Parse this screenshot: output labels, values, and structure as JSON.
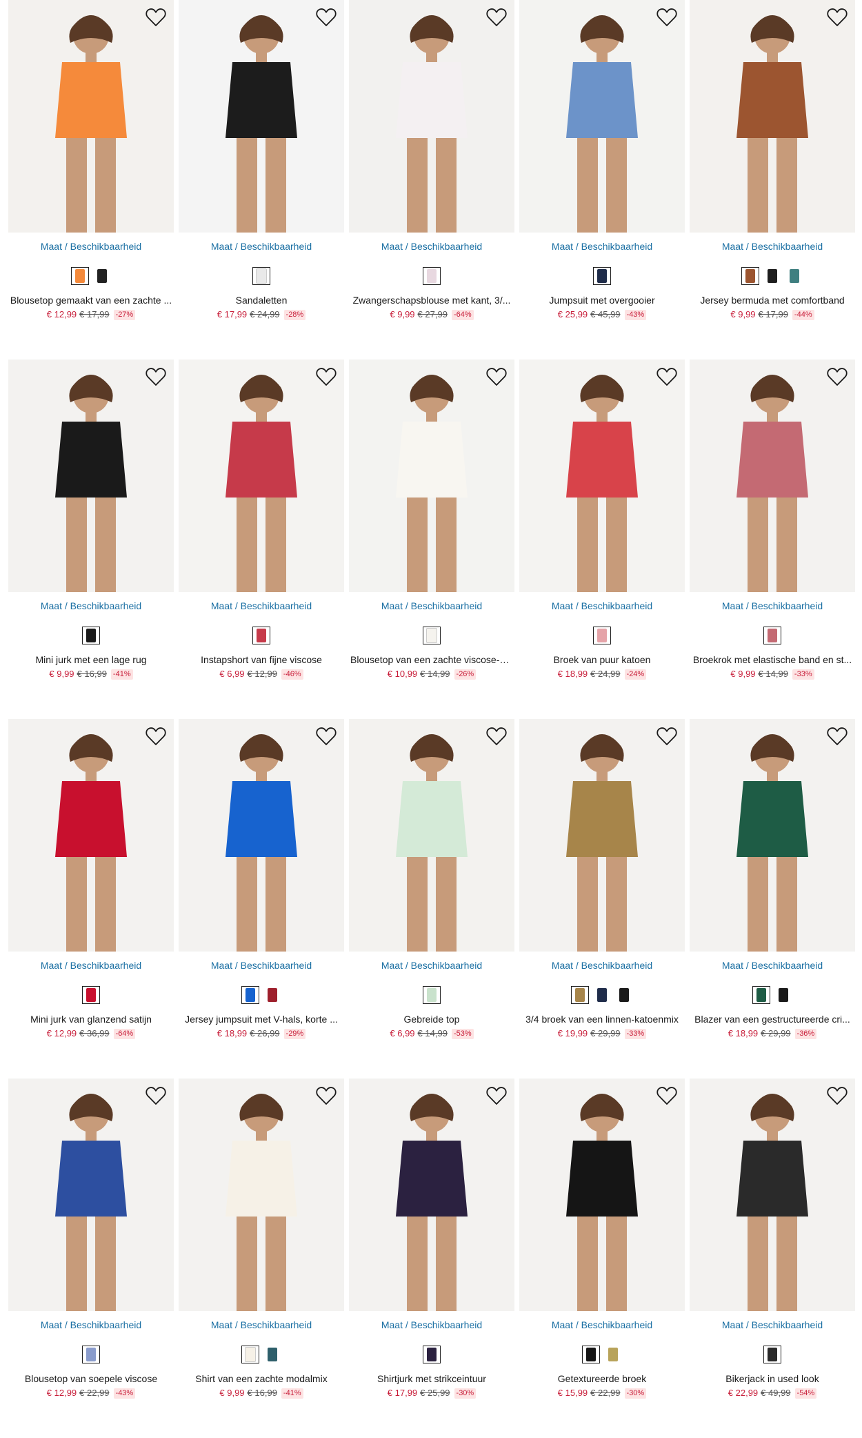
{
  "size_link_label": "Maat / Beschikbaarheid",
  "products": [
    {
      "title": "Blousetop gemaakt van een zachte ...",
      "price": "€ 12,99",
      "old_price": "€ 17,99",
      "discount": "-27%",
      "bg": "#f3f1ee",
      "garment": "#f58a3b",
      "swatches": [
        "#f58a3b",
        "#222222"
      ],
      "icon": "heart-outline-icon"
    },
    {
      "title": "Sandaletten",
      "price": "€ 17,99",
      "old_price": "€ 24,99",
      "discount": "-28%",
      "bg": "#f4f4f4",
      "garment": "#1c1c1c",
      "swatches": [
        "#e9e9e9"
      ],
      "icon": "heart-outline-icon"
    },
    {
      "title": "Zwangerschapsblouse met kant, 3/...",
      "price": "€ 9,99",
      "old_price": "€ 27,99",
      "discount": "-64%",
      "bg": "#f2f1ef",
      "garment": "#f4f0f2",
      "swatches": [
        "#e8d8e0"
      ],
      "icon": "heart-outline-icon"
    },
    {
      "title": "Jumpsuit met overgooier",
      "price": "€ 25,99",
      "old_price": "€ 45,99",
      "discount": "-43%",
      "bg": "#f3f3f1",
      "garment": "#6c93c9",
      "swatches": [
        "#1f2c4a"
      ],
      "icon": "heart-outline-icon"
    },
    {
      "title": "Jersey bermuda met comfortband",
      "price": "€ 9,99",
      "old_price": "€ 17,99",
      "discount": "-44%",
      "bg": "#f3f1ee",
      "garment": "#9c5530",
      "swatches": [
        "#9c5530",
        "#1e1e1e",
        "#3f7f80"
      ],
      "icon": "heart-outline-icon"
    },
    {
      "title": "Mini jurk met een lage rug",
      "price": "€ 9,99",
      "old_price": "€ 16,99",
      "discount": "-41%",
      "bg": "#f3f2f0",
      "garment": "#1a1a1a",
      "swatches": [
        "#1a1a1a"
      ],
      "icon": "heart-outline-icon"
    },
    {
      "title": "Instapshort van fijne viscose",
      "price": "€ 6,99",
      "old_price": "€ 12,99",
      "discount": "-46%",
      "bg": "#f4f3f1",
      "garment": "#c63a4a",
      "swatches": [
        "#c63a4a"
      ],
      "icon": "heart-outline-icon"
    },
    {
      "title": "Blousetop van een zachte viscose-mix",
      "price": "€ 10,99",
      "old_price": "€ 14,99",
      "discount": "-26%",
      "bg": "#f3f3f1",
      "garment": "#f8f6f1",
      "swatches": [
        "#f5f3ee"
      ],
      "icon": "heart-outline-icon"
    },
    {
      "title": "Broek van puur katoen",
      "price": "€ 18,99",
      "old_price": "€ 24,99",
      "discount": "-24%",
      "bg": "#f4f3f1",
      "garment": "#d8434a",
      "swatches": [
        "#e5a3a8"
      ],
      "icon": "heart-outline-icon"
    },
    {
      "title": "Broekrok met elastische band en st...",
      "price": "€ 9,99",
      "old_price": "€ 14,99",
      "discount": "-33%",
      "bg": "#f3f2f0",
      "garment": "#c46a73",
      "swatches": [
        "#c46a73"
      ],
      "icon": "heart-outline-icon"
    },
    {
      "title": "Mini jurk van glanzend satijn",
      "price": "€ 12,99",
      "old_price": "€ 36,99",
      "discount": "-64%",
      "bg": "#f3f2f0",
      "garment": "#c8102e",
      "swatches": [
        "#c8102e"
      ],
      "icon": "heart-outline-icon"
    },
    {
      "title": "Jersey jumpsuit met V-hals, korte ...",
      "price": "€ 18,99",
      "old_price": "€ 26,99",
      "discount": "-29%",
      "bg": "#f3f2f0",
      "garment": "#1763cf",
      "swatches": [
        "#1763cf",
        "#9e1f2c"
      ],
      "icon": "heart-outline-icon"
    },
    {
      "title": "Gebreide top",
      "price": "€ 6,99",
      "old_price": "€ 14,99",
      "discount": "-53%",
      "bg": "#f3f2ef",
      "garment": "#d4ead7",
      "swatches": [
        "#c9e2cc"
      ],
      "icon": "heart-outline-icon"
    },
    {
      "title": "3/4 broek van een linnen-katoenmix",
      "price": "€ 19,99",
      "old_price": "€ 29,99",
      "discount": "-33%",
      "bg": "#f3f2f0",
      "garment": "#a7854a",
      "swatches": [
        "#a7854a",
        "#1f2c4a",
        "#1a1a1a"
      ],
      "icon": "heart-outline-icon"
    },
    {
      "title": "Blazer van een gestructureerde cri...",
      "price": "€ 18,99",
      "old_price": "€ 29,99",
      "discount": "-36%",
      "bg": "#f3f2f0",
      "garment": "#1e5c45",
      "swatches": [
        "#1e5c45",
        "#1a1a1a"
      ],
      "icon": "heart-outline-icon"
    },
    {
      "title": "Blousetop van soepele viscose",
      "price": "€ 12,99",
      "old_price": "€ 22,99",
      "discount": "-43%",
      "bg": "#f3f2f0",
      "garment": "#2d4fa0",
      "swatches": [
        "#8a9ccc"
      ],
      "icon": "heart-outline-icon"
    },
    {
      "title": "Shirt van een zachte modalmix",
      "price": "€ 9,99",
      "old_price": "€ 16,99",
      "discount": "-41%",
      "bg": "#f3f2f0",
      "garment": "#f6f1e7",
      "swatches": [
        "#f6f1e7",
        "#2e5f6b"
      ],
      "icon": "heart-outline-icon"
    },
    {
      "title": "Shirtjurk met strikceintuur",
      "price": "€ 17,99",
      "old_price": "€ 25,99",
      "discount": "-30%",
      "bg": "#f3f2f0",
      "garment": "#2b2140",
      "swatches": [
        "#2b2140"
      ],
      "icon": "heart-outline-icon"
    },
    {
      "title": "Getextureerde broek",
      "price": "€ 15,99",
      "old_price": "€ 22,99",
      "discount": "-30%",
      "bg": "#f3f2f0",
      "garment": "#151515",
      "swatches": [
        "#151515",
        "#b8a35a"
      ],
      "icon": "heart-outline-icon"
    },
    {
      "title": "Bikerjack in used look",
      "price": "€ 22,99",
      "old_price": "€ 49,99",
      "discount": "-54%",
      "bg": "#f3f2f0",
      "garment": "#2a2a2a",
      "swatches": [
        "#2a2a2a"
      ],
      "icon": "heart-outline-icon"
    }
  ]
}
